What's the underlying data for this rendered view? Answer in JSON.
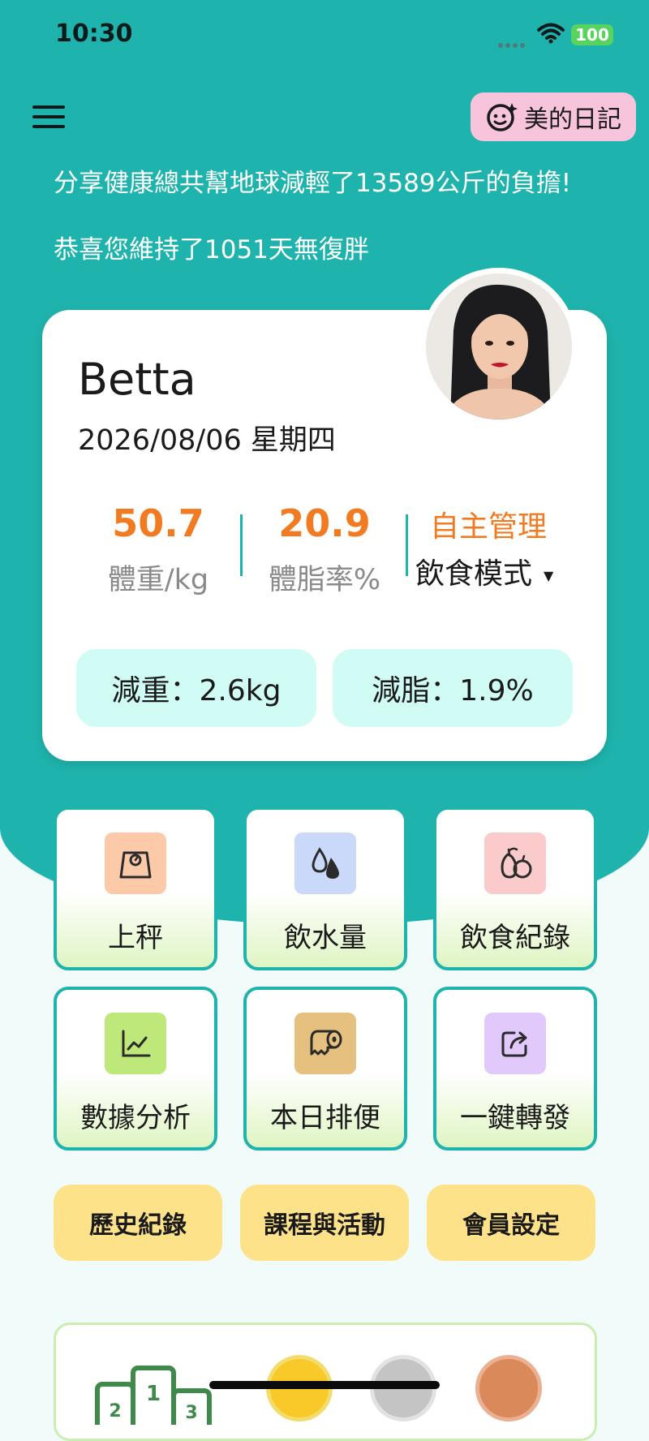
{
  "status_bar": {
    "time": "10:30",
    "battery": "100"
  },
  "header": {
    "diary_label": "美的日記"
  },
  "banner": {
    "line1": "分享健康總共幫地球減輕了13589公斤的負擔!",
    "line2": "恭喜您維持了1051天無復胖"
  },
  "profile": {
    "name": "Betta",
    "date": "2026/08/06 星期四",
    "weight_value": "50.7",
    "weight_label": "體重/kg",
    "fat_value": "20.9",
    "fat_label": "體脂率%",
    "mode_title": "自主管理",
    "mode_selected": "飲食模式",
    "loss_weight": "減重：2.6kg",
    "loss_fat": "減脂：1.9%"
  },
  "tiles": [
    {
      "label": "上秤",
      "icon": "scale-icon",
      "color": "#fcc9a9"
    },
    {
      "label": "飲水量",
      "icon": "water-drops-icon",
      "color": "#cad8fa"
    },
    {
      "label": "飲食紀錄",
      "icon": "fruit-icon",
      "color": "#fbcaca"
    },
    {
      "label": "數據分析",
      "icon": "chart-icon",
      "color": "#bfe87a"
    },
    {
      "label": "本日排便",
      "icon": "toilet-paper-icon",
      "color": "#e5c07f"
    },
    {
      "label": "一鍵轉發",
      "icon": "share-icon",
      "color": "#e2c9fb"
    }
  ],
  "buttons": {
    "history": "歷史紀錄",
    "courses": "課程與活動",
    "settings": "會員設定"
  },
  "colors": {
    "primary": "#1fb3ad",
    "accent": "#f27a21",
    "pill": "#d0fcf5",
    "button": "#fde28a"
  }
}
